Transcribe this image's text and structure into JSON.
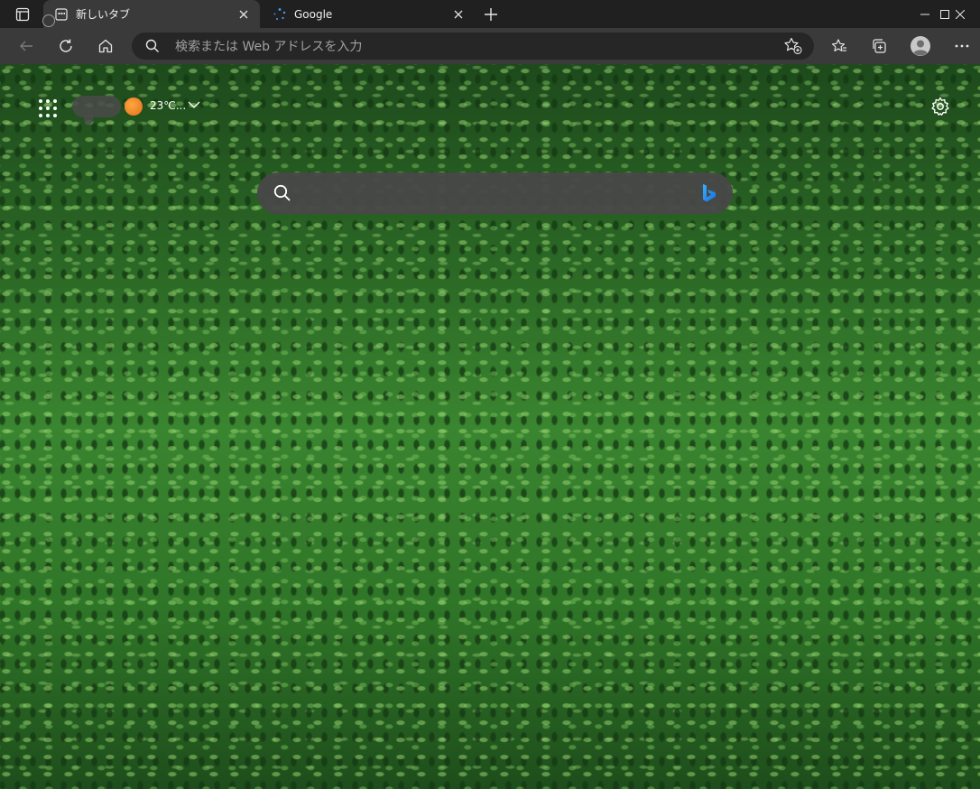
{
  "tabs": [
    {
      "title": "新しいタブ",
      "active": true,
      "icon": "new-tab-page-icon"
    },
    {
      "title": "Google",
      "active": false,
      "icon": "google-loading-icon"
    }
  ],
  "address_bar": {
    "placeholder": "検索または Web アドレスを入力",
    "value": ""
  },
  "new_tab_page": {
    "weather": {
      "temperature": "23℃...",
      "icon": "weather-sun-icon"
    },
    "search": {
      "placeholder": "",
      "value": ""
    }
  },
  "colors": {
    "titlebar": "#202020",
    "toolbar": "#3a3a3a",
    "address_bar": "#262626",
    "bing_accent": "#1a9fff"
  }
}
